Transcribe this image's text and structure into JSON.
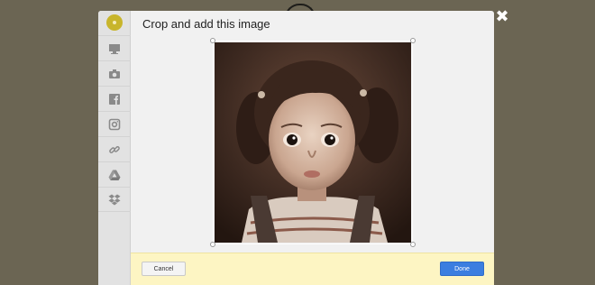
{
  "dialog": {
    "title": "Crop and add this image"
  },
  "sidebar": {
    "items": [
      {
        "icon": "monitor-icon"
      },
      {
        "icon": "camera-icon"
      },
      {
        "icon": "facebook-icon"
      },
      {
        "icon": "instagram-icon"
      },
      {
        "icon": "link-icon"
      },
      {
        "icon": "google-drive-icon"
      },
      {
        "icon": "dropbox-icon"
      }
    ]
  },
  "footer": {
    "cancel_label": "Cancel",
    "done_label": "Done"
  },
  "colors": {
    "backdrop": "#6b6553",
    "primary_button": "#3b7ee0",
    "footer_bg": "#fdf5c3",
    "logo": "#c8b52c"
  }
}
